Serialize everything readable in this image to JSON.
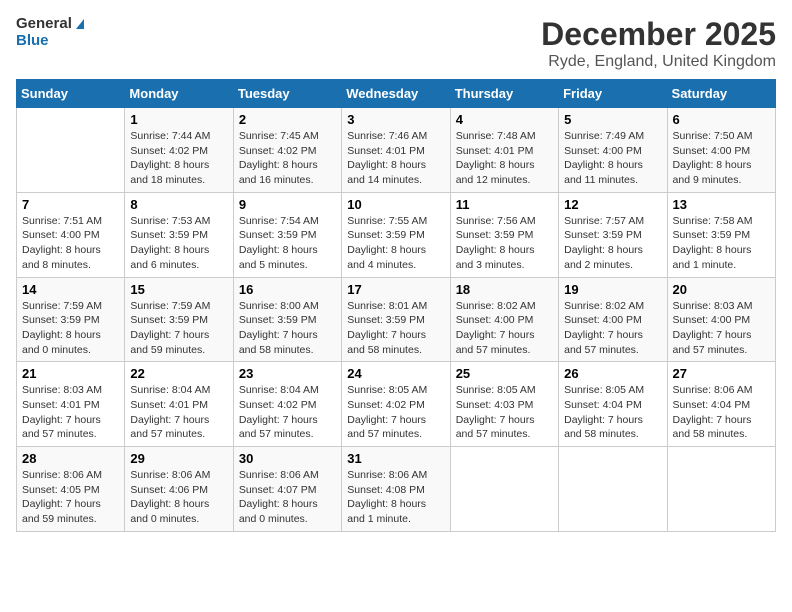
{
  "logo": {
    "line1": "General",
    "line2": "Blue"
  },
  "title": "December 2025",
  "location": "Ryde, England, United Kingdom",
  "days_of_week": [
    "Sunday",
    "Monday",
    "Tuesday",
    "Wednesday",
    "Thursday",
    "Friday",
    "Saturday"
  ],
  "weeks": [
    [
      {
        "day": "",
        "info": ""
      },
      {
        "day": "1",
        "info": "Sunrise: 7:44 AM\nSunset: 4:02 PM\nDaylight: 8 hours\nand 18 minutes."
      },
      {
        "day": "2",
        "info": "Sunrise: 7:45 AM\nSunset: 4:02 PM\nDaylight: 8 hours\nand 16 minutes."
      },
      {
        "day": "3",
        "info": "Sunrise: 7:46 AM\nSunset: 4:01 PM\nDaylight: 8 hours\nand 14 minutes."
      },
      {
        "day": "4",
        "info": "Sunrise: 7:48 AM\nSunset: 4:01 PM\nDaylight: 8 hours\nand 12 minutes."
      },
      {
        "day": "5",
        "info": "Sunrise: 7:49 AM\nSunset: 4:00 PM\nDaylight: 8 hours\nand 11 minutes."
      },
      {
        "day": "6",
        "info": "Sunrise: 7:50 AM\nSunset: 4:00 PM\nDaylight: 8 hours\nand 9 minutes."
      }
    ],
    [
      {
        "day": "7",
        "info": "Sunrise: 7:51 AM\nSunset: 4:00 PM\nDaylight: 8 hours\nand 8 minutes."
      },
      {
        "day": "8",
        "info": "Sunrise: 7:53 AM\nSunset: 3:59 PM\nDaylight: 8 hours\nand 6 minutes."
      },
      {
        "day": "9",
        "info": "Sunrise: 7:54 AM\nSunset: 3:59 PM\nDaylight: 8 hours\nand 5 minutes."
      },
      {
        "day": "10",
        "info": "Sunrise: 7:55 AM\nSunset: 3:59 PM\nDaylight: 8 hours\nand 4 minutes."
      },
      {
        "day": "11",
        "info": "Sunrise: 7:56 AM\nSunset: 3:59 PM\nDaylight: 8 hours\nand 3 minutes."
      },
      {
        "day": "12",
        "info": "Sunrise: 7:57 AM\nSunset: 3:59 PM\nDaylight: 8 hours\nand 2 minutes."
      },
      {
        "day": "13",
        "info": "Sunrise: 7:58 AM\nSunset: 3:59 PM\nDaylight: 8 hours\nand 1 minute."
      }
    ],
    [
      {
        "day": "14",
        "info": "Sunrise: 7:59 AM\nSunset: 3:59 PM\nDaylight: 8 hours\nand 0 minutes."
      },
      {
        "day": "15",
        "info": "Sunrise: 7:59 AM\nSunset: 3:59 PM\nDaylight: 7 hours\nand 59 minutes."
      },
      {
        "day": "16",
        "info": "Sunrise: 8:00 AM\nSunset: 3:59 PM\nDaylight: 7 hours\nand 58 minutes."
      },
      {
        "day": "17",
        "info": "Sunrise: 8:01 AM\nSunset: 3:59 PM\nDaylight: 7 hours\nand 58 minutes."
      },
      {
        "day": "18",
        "info": "Sunrise: 8:02 AM\nSunset: 4:00 PM\nDaylight: 7 hours\nand 57 minutes."
      },
      {
        "day": "19",
        "info": "Sunrise: 8:02 AM\nSunset: 4:00 PM\nDaylight: 7 hours\nand 57 minutes."
      },
      {
        "day": "20",
        "info": "Sunrise: 8:03 AM\nSunset: 4:00 PM\nDaylight: 7 hours\nand 57 minutes."
      }
    ],
    [
      {
        "day": "21",
        "info": "Sunrise: 8:03 AM\nSunset: 4:01 PM\nDaylight: 7 hours\nand 57 minutes."
      },
      {
        "day": "22",
        "info": "Sunrise: 8:04 AM\nSunset: 4:01 PM\nDaylight: 7 hours\nand 57 minutes."
      },
      {
        "day": "23",
        "info": "Sunrise: 8:04 AM\nSunset: 4:02 PM\nDaylight: 7 hours\nand 57 minutes."
      },
      {
        "day": "24",
        "info": "Sunrise: 8:05 AM\nSunset: 4:02 PM\nDaylight: 7 hours\nand 57 minutes."
      },
      {
        "day": "25",
        "info": "Sunrise: 8:05 AM\nSunset: 4:03 PM\nDaylight: 7 hours\nand 57 minutes."
      },
      {
        "day": "26",
        "info": "Sunrise: 8:05 AM\nSunset: 4:04 PM\nDaylight: 7 hours\nand 58 minutes."
      },
      {
        "day": "27",
        "info": "Sunrise: 8:06 AM\nSunset: 4:04 PM\nDaylight: 7 hours\nand 58 minutes."
      }
    ],
    [
      {
        "day": "28",
        "info": "Sunrise: 8:06 AM\nSunset: 4:05 PM\nDaylight: 7 hours\nand 59 minutes."
      },
      {
        "day": "29",
        "info": "Sunrise: 8:06 AM\nSunset: 4:06 PM\nDaylight: 8 hours\nand 0 minutes."
      },
      {
        "day": "30",
        "info": "Sunrise: 8:06 AM\nSunset: 4:07 PM\nDaylight: 8 hours\nand 0 minutes."
      },
      {
        "day": "31",
        "info": "Sunrise: 8:06 AM\nSunset: 4:08 PM\nDaylight: 8 hours\nand 1 minute."
      },
      {
        "day": "",
        "info": ""
      },
      {
        "day": "",
        "info": ""
      },
      {
        "day": "",
        "info": ""
      }
    ]
  ]
}
